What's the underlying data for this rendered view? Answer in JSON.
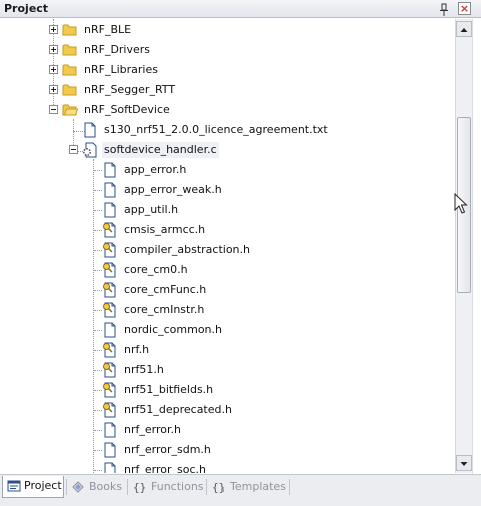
{
  "panel": {
    "title": "Project"
  },
  "tree": {
    "items": [
      {
        "label": "nRF_BLE",
        "type": "folder",
        "state": "collapsed"
      },
      {
        "label": "nRF_Drivers",
        "type": "folder",
        "state": "collapsed"
      },
      {
        "label": "nRF_Libraries",
        "type": "folder",
        "state": "collapsed"
      },
      {
        "label": "nRF_Segger_RTT",
        "type": "folder",
        "state": "collapsed"
      },
      {
        "label": "nRF_SoftDevice",
        "type": "folder-open",
        "state": "expanded"
      },
      {
        "label": "s130_nrf51_2.0.0_licence_agreement.txt",
        "type": "file"
      },
      {
        "label": "softdevice_handler.c",
        "type": "source-file",
        "state": "expanded"
      },
      {
        "label": "app_error.h",
        "type": "header"
      },
      {
        "label": "app_error_weak.h",
        "type": "header"
      },
      {
        "label": "app_util.h",
        "type": "header"
      },
      {
        "label": "cmsis_armcc.h",
        "type": "header-locked"
      },
      {
        "label": "compiler_abstraction.h",
        "type": "header-locked"
      },
      {
        "label": "core_cm0.h",
        "type": "header-locked"
      },
      {
        "label": "core_cmFunc.h",
        "type": "header-locked"
      },
      {
        "label": "core_cmInstr.h",
        "type": "header-locked"
      },
      {
        "label": "nordic_common.h",
        "type": "header"
      },
      {
        "label": "nrf.h",
        "type": "header-locked"
      },
      {
        "label": "nrf51.h",
        "type": "header-locked"
      },
      {
        "label": "nrf51_bitfields.h",
        "type": "header-locked"
      },
      {
        "label": "nrf51_deprecated.h",
        "type": "header-locked"
      },
      {
        "label": "nrf_error.h",
        "type": "header"
      },
      {
        "label": "nrf_error_sdm.h",
        "type": "header"
      },
      {
        "label": "nrf_error_soc.h",
        "type": "header"
      }
    ]
  },
  "tabs": [
    {
      "label": "Project",
      "icon": "project-icon",
      "active": true
    },
    {
      "label": "Books",
      "icon": "books-icon",
      "active": false
    },
    {
      "label": "Functions",
      "icon": "functions-icon",
      "active": false
    },
    {
      "label": "Templates",
      "icon": "templates-icon",
      "active": false
    }
  ],
  "colors": {
    "folder": "#f2c94c",
    "folder_border": "#c99a1d",
    "selection": "#eef0f5",
    "close": "#c0392b"
  }
}
